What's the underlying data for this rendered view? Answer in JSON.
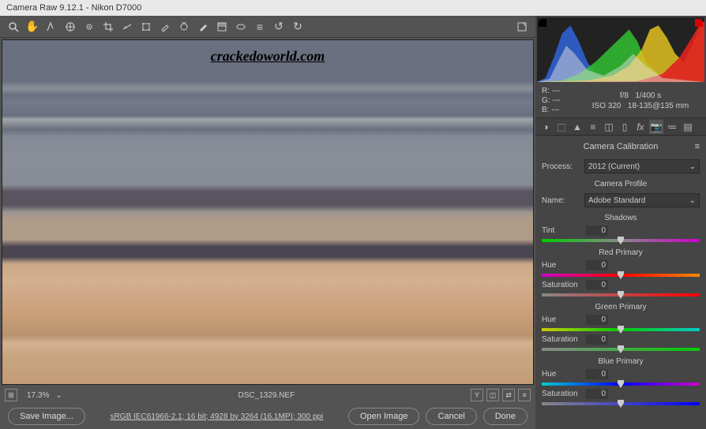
{
  "title": "Camera Raw 9.12.1  -  Nikon D7000",
  "watermark": "crackedoworld.com",
  "zoom": "17.3%",
  "filename": "DSC_1329.NEF",
  "metadata_footer": "sRGB IEC61966-2.1; 16 bit; 4928 by 3264 (16.1MP); 300 ppi",
  "rgb": {
    "R": "R:",
    "G": "G:",
    "B": "B:",
    "rv": "---",
    "gv": "---",
    "bv": "---"
  },
  "exposure": {
    "line1_a": "f/8",
    "line1_b": "1/400 s",
    "line2_a": "ISO 320",
    "line2_b": "18-135@135 mm"
  },
  "panel_title": "Camera Calibration",
  "process_label": "Process:",
  "process_value": "2012 (Current)",
  "profile_header": "Camera Profile",
  "name_label": "Name:",
  "name_value": "Adobe Standard",
  "shadows": {
    "header": "Shadows",
    "tint_label": "Tint",
    "tint_val": "0"
  },
  "red": {
    "header": "Red Primary",
    "hue_label": "Hue",
    "hue_val": "0",
    "sat_label": "Saturation",
    "sat_val": "0"
  },
  "green": {
    "header": "Green Primary",
    "hue_label": "Hue",
    "hue_val": "0",
    "sat_label": "Saturation",
    "sat_val": "0"
  },
  "blue": {
    "header": "Blue Primary",
    "hue_label": "Hue",
    "hue_val": "0",
    "sat_label": "Saturation",
    "sat_val": "0"
  },
  "buttons": {
    "save": "Save Image...",
    "open": "Open Image",
    "cancel": "Cancel",
    "done": "Done"
  },
  "y_label": "Y"
}
